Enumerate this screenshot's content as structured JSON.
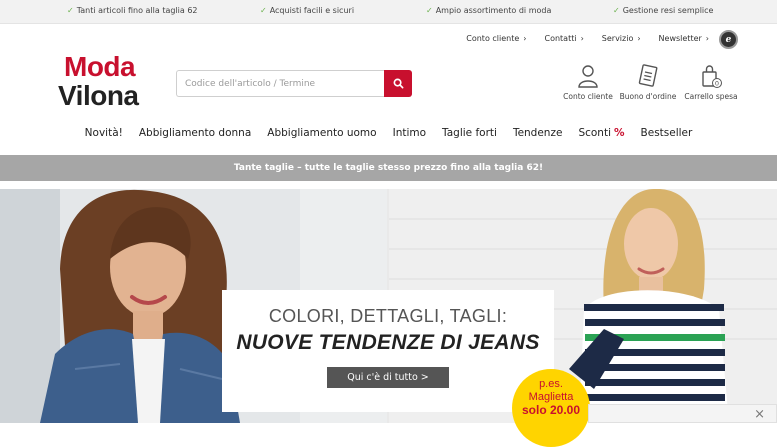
{
  "usp_bar": {
    "items": [
      "Tanti articoli fino alla taglia 62",
      "Acquisti facili e sicuri",
      "Ampio assortimento di moda",
      "Gestione resi semplice"
    ]
  },
  "service_links": [
    {
      "label": "Conto cliente",
      "arrow": "›"
    },
    {
      "label": "Contatti",
      "arrow": "›"
    },
    {
      "label": "Servizio",
      "arrow": "›"
    },
    {
      "label": "Newsletter",
      "arrow": "›"
    }
  ],
  "trust_badge": "e",
  "logo": {
    "line1": "Moda",
    "line2": "Vilona"
  },
  "search": {
    "placeholder": "Codice dell'articolo / Termine",
    "icon": "search-icon"
  },
  "account": [
    {
      "label": "Conto cliente",
      "icon": "user-icon"
    },
    {
      "label": "Buono d'ordine",
      "icon": "order-form-icon"
    },
    {
      "label": "Carrello spesa",
      "icon": "shopping-bag-icon",
      "count": "0"
    }
  ],
  "nav": [
    {
      "label": "Novità!"
    },
    {
      "label": "Abbigliamento donna"
    },
    {
      "label": "Abbigliamento uomo"
    },
    {
      "label": "Intimo"
    },
    {
      "label": "Taglie forti"
    },
    {
      "label": "Tendenze"
    },
    {
      "label": "Sconti",
      "suffix": "%"
    },
    {
      "label": "Bestseller"
    }
  ],
  "promo_bar": "Tante taglie – tutte le taglie stesso prezzo fino alla taglia 62!",
  "hero": {
    "subtitle": "COLORI, DETTAGLI, TAGLI:",
    "title": "NUOVE TENDENZE DI JEANS",
    "cta": "Qui c'è di tutto >"
  },
  "price_badge": {
    "line1": "p.es.",
    "line2": "Maglietta",
    "line3": "solo 20.00"
  },
  "chat_close": "×",
  "colors": {
    "brand_red": "#c8102e",
    "check_green": "#6ab04c",
    "promo_gray": "#a6a6a6",
    "badge_yellow": "#ffd400"
  }
}
